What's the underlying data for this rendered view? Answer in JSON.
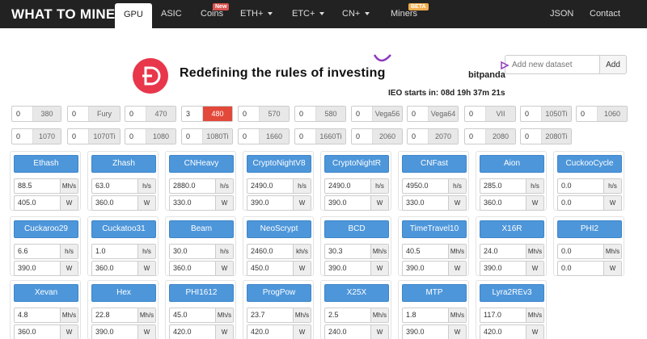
{
  "nav": {
    "brand": "WHAT TO MINE",
    "items": [
      {
        "label": "GPU",
        "active": true
      },
      {
        "label": "ASIC"
      },
      {
        "label": "Coins",
        "badge": "New"
      },
      {
        "label": "ETH+",
        "dropdown": true
      },
      {
        "label": "ETC+",
        "dropdown": true
      },
      {
        "label": "CN+",
        "dropdown": true
      },
      {
        "label": "Miners",
        "badge": "BETA"
      },
      {
        "label": "JSON"
      },
      {
        "label": "Contact"
      }
    ]
  },
  "dataset": {
    "placeholder": "Add new dataset",
    "button": "Add"
  },
  "ad": {
    "headline": "Redefining the rules of investing",
    "brand": "bitpanda",
    "ieo": "IEO starts in: 08d 19h 37m 21s",
    "accent": "#e8364b"
  },
  "gpus": {
    "row1": [
      {
        "count": "0",
        "label": "380"
      },
      {
        "count": "0",
        "label": "Fury"
      },
      {
        "count": "0",
        "label": "470"
      },
      {
        "count": "3",
        "label": "480",
        "highlight": true
      },
      {
        "count": "0",
        "label": "570"
      },
      {
        "count": "0",
        "label": "580"
      },
      {
        "count": "0",
        "label": "Vega56"
      },
      {
        "count": "0",
        "label": "Vega64"
      },
      {
        "count": "0",
        "label": "VII"
      },
      {
        "count": "0",
        "label": "1050Ti"
      },
      {
        "count": "0",
        "label": "1060"
      }
    ],
    "row2": [
      {
        "count": "0",
        "label": "1070"
      },
      {
        "count": "0",
        "label": "1070Ti"
      },
      {
        "count": "0",
        "label": "1080"
      },
      {
        "count": "0",
        "label": "1080Ti"
      },
      {
        "count": "0",
        "label": "1660"
      },
      {
        "count": "0",
        "label": "1660Ti"
      },
      {
        "count": "0",
        "label": "2060"
      },
      {
        "count": "0",
        "label": "2070"
      },
      {
        "count": "0",
        "label": "2080"
      },
      {
        "count": "0",
        "label": "2080Ti"
      }
    ]
  },
  "algos": {
    "row1": [
      {
        "name": "Ethash",
        "hashrate": "88.5",
        "hr_unit": "Mh/s",
        "power": "405.0",
        "pw_unit": "W"
      },
      {
        "name": "Zhash",
        "hashrate": "63.0",
        "hr_unit": "h/s",
        "power": "360.0",
        "pw_unit": "W"
      },
      {
        "name": "CNHeavy",
        "hashrate": "2880.0",
        "hr_unit": "h/s",
        "power": "330.0",
        "pw_unit": "W"
      },
      {
        "name": "CryptoNightV8",
        "hashrate": "2490.0",
        "hr_unit": "h/s",
        "power": "390.0",
        "pw_unit": "W"
      },
      {
        "name": "CryptoNightR",
        "hashrate": "2490.0",
        "hr_unit": "h/s",
        "power": "390.0",
        "pw_unit": "W"
      },
      {
        "name": "CNFast",
        "hashrate": "4950.0",
        "hr_unit": "h/s",
        "power": "330.0",
        "pw_unit": "W"
      },
      {
        "name": "Aion",
        "hashrate": "285.0",
        "hr_unit": "h/s",
        "power": "360.0",
        "pw_unit": "W"
      },
      {
        "name": "CuckooCycle",
        "hashrate": "0.0",
        "hr_unit": "h/s",
        "power": "0.0",
        "pw_unit": "W"
      }
    ],
    "row2": [
      {
        "name": "Cuckaroo29",
        "hashrate": "6.6",
        "hr_unit": "h/s",
        "power": "390.0",
        "pw_unit": "W"
      },
      {
        "name": "Cuckatoo31",
        "hashrate": "1.0",
        "hr_unit": "h/s",
        "power": "360.0",
        "pw_unit": "W"
      },
      {
        "name": "Beam",
        "hashrate": "30.0",
        "hr_unit": "h/s",
        "power": "360.0",
        "pw_unit": "W"
      },
      {
        "name": "NeoScrypt",
        "hashrate": "2460.0",
        "hr_unit": "kh/s",
        "power": "450.0",
        "pw_unit": "W"
      },
      {
        "name": "BCD",
        "hashrate": "30.3",
        "hr_unit": "Mh/s",
        "power": "390.0",
        "pw_unit": "W"
      },
      {
        "name": "TimeTravel10",
        "hashrate": "40.5",
        "hr_unit": "Mh/s",
        "power": "390.0",
        "pw_unit": "W"
      },
      {
        "name": "X16R",
        "hashrate": "24.0",
        "hr_unit": "Mh/s",
        "power": "390.0",
        "pw_unit": "W"
      },
      {
        "name": "PHI2",
        "hashrate": "0.0",
        "hr_unit": "Mh/s",
        "power": "0.0",
        "pw_unit": "W"
      }
    ],
    "row3": [
      {
        "name": "Xevan",
        "hashrate": "4.8",
        "hr_unit": "Mh/s",
        "power": "360.0",
        "pw_unit": "W"
      },
      {
        "name": "Hex",
        "hashrate": "22.8",
        "hr_unit": "Mh/s",
        "power": "390.0",
        "pw_unit": "W"
      },
      {
        "name": "PHI1612",
        "hashrate": "45.0",
        "hr_unit": "Mh/s",
        "power": "420.0",
        "pw_unit": "W"
      },
      {
        "name": "ProgPow",
        "hashrate": "23.7",
        "hr_unit": "Mh/s",
        "power": "420.0",
        "pw_unit": "W"
      },
      {
        "name": "X25X",
        "hashrate": "2.5",
        "hr_unit": "Mh/s",
        "power": "240.0",
        "pw_unit": "W"
      },
      {
        "name": "MTP",
        "hashrate": "1.8",
        "hr_unit": "Mh/s",
        "power": "390.0",
        "pw_unit": "W"
      },
      {
        "name": "Lyra2REv3",
        "hashrate": "117.0",
        "hr_unit": "Mh/s",
        "power": "420.0",
        "pw_unit": "W"
      }
    ]
  }
}
